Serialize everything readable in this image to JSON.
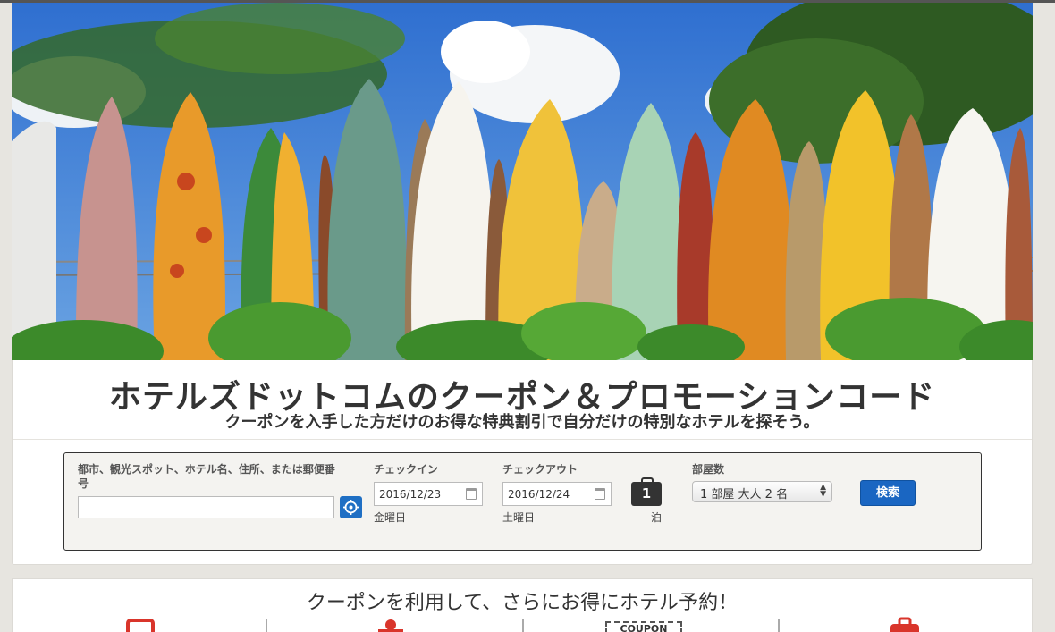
{
  "hero": {
    "description_icon": "surfboards-image"
  },
  "header": {
    "title": "ホテルズドットコムのクーポン＆プロモーションコード",
    "subtitle": "クーポンを入手した方だけのお得な特典割引で自分だけの特別なホテルを探そう。"
  },
  "search": {
    "destination_label": "都市、観光スポット、ホテル名、住所、または郵便番号",
    "destination_value": "",
    "checkin_label": "チェックイン",
    "checkin_value": "2016/12/23",
    "checkin_day": "金曜日",
    "checkout_label": "チェックアウト",
    "checkout_value": "2016/12/24",
    "checkout_day": "土曜日",
    "nights_count": "1",
    "nights_unit": "泊",
    "rooms_label": "部屋数",
    "rooms_value": "1 部屋 大人 2 名",
    "search_button": "検索"
  },
  "promo": {
    "title": "クーポンを利用して、さらにお得にホテル予約！",
    "coupon_icon_text": "COUPON"
  },
  "colors": {
    "accent_blue": "#1a66c2",
    "icon_red": "#d9352b"
  }
}
